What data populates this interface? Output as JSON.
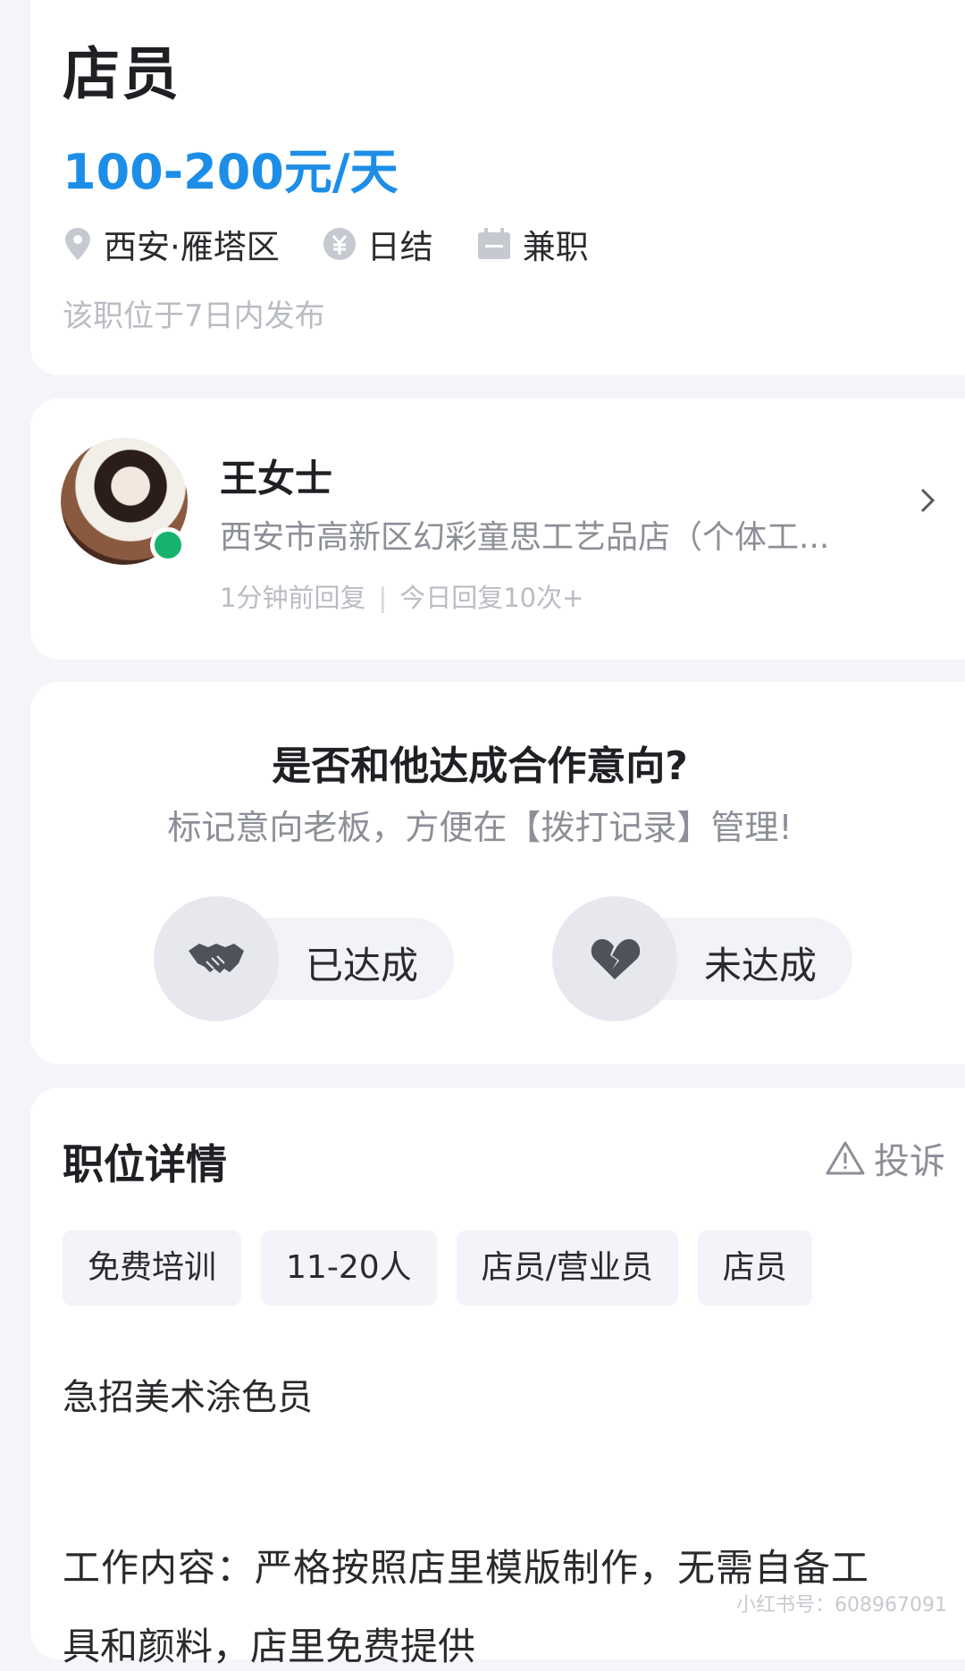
{
  "job": {
    "title": "店员",
    "salary": "100-200元/天",
    "location": "西安·雁塔区",
    "settlement": "日结",
    "type": "兼职",
    "posted": "该职位于7日内发布"
  },
  "boss": {
    "name": "王女士",
    "company": "西安市高新区幻彩童思工艺品店（个体工...",
    "reply_time": "1分钟前回复",
    "reply_count": "今日回复10次+"
  },
  "intent": {
    "question": "是否和他达成合作意向?",
    "subtitle": "标记意向老板，方便在【拨打记录】管理!",
    "yes_label": "已达成",
    "no_label": "未达成"
  },
  "detail": {
    "title": "职位详情",
    "report_label": "投诉",
    "tags": [
      "免费培训",
      "11-20人",
      "店员/营业员",
      "店员"
    ],
    "line1": "急招美术涂色员",
    "line2": "工作内容：严格按照店里模版制作，无需自备工",
    "line3": "具和颜料，店里免费提供"
  },
  "watermark": "小红书号：608967091",
  "colors": {
    "salary": "#1d8ee8",
    "online": "#17b36d"
  },
  "icons": [
    "location-pin-icon",
    "coin-icon",
    "calendar-icon",
    "chevron-right-icon",
    "handshake-icon",
    "broken-heart-icon",
    "warning-icon"
  ]
}
